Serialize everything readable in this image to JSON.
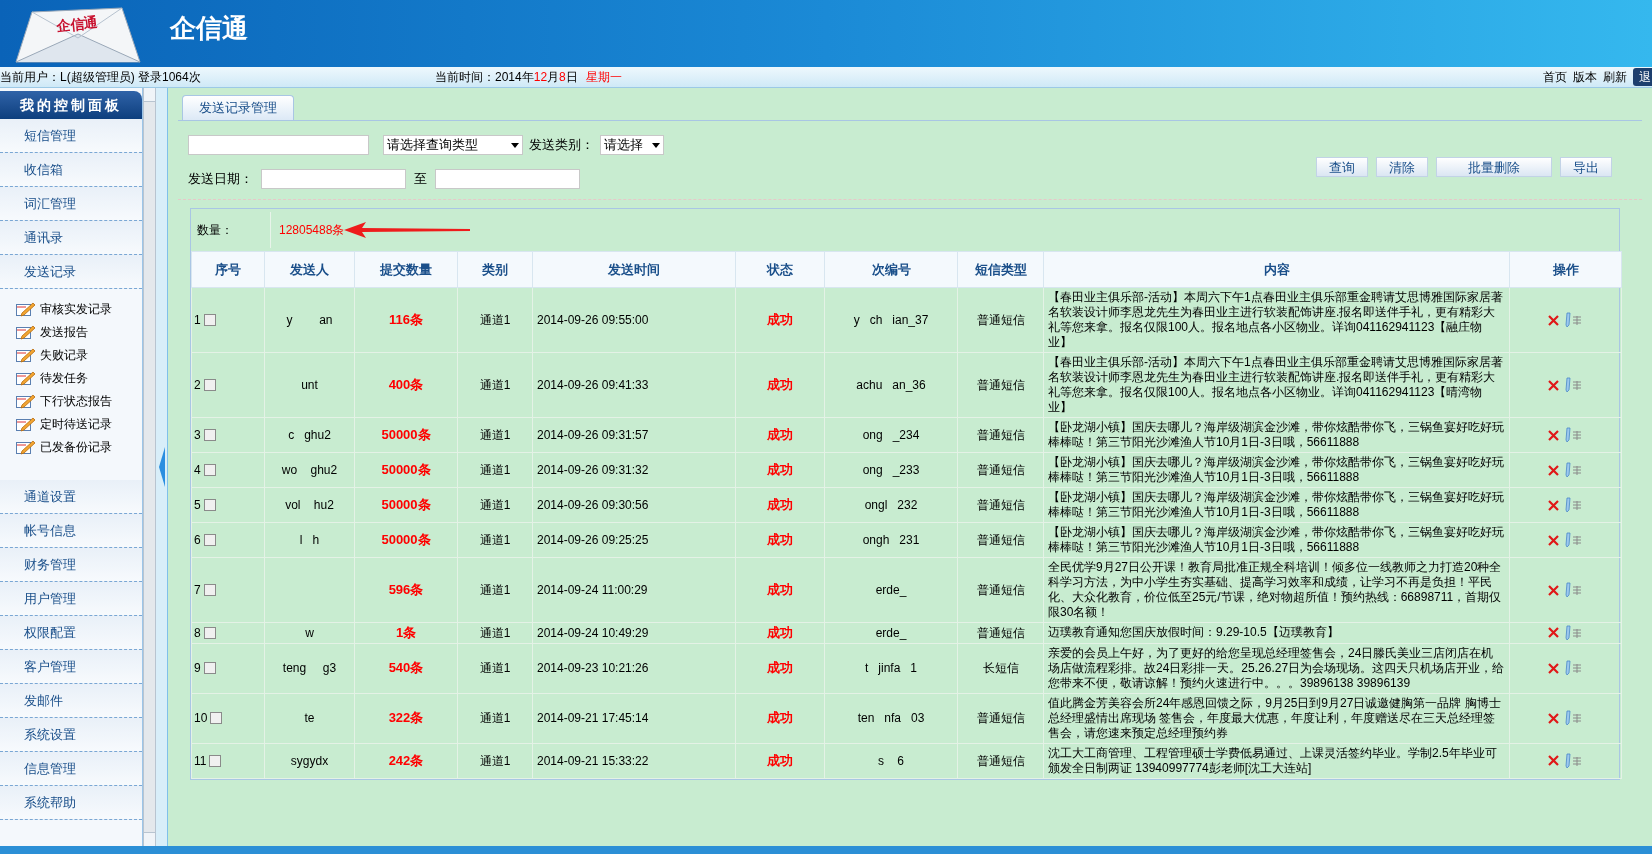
{
  "header": {
    "logo_text": "企信通",
    "brand": "企信通"
  },
  "info_bar": {
    "user": "当前用户：L(超级管理员) 登录1064次",
    "time_label": "当前时间：",
    "date_parts": [
      {
        "text": "2014年",
        "highlight": false
      },
      {
        "text": "12",
        "highlight": true
      },
      {
        "text": "月",
        "highlight": false
      },
      {
        "text": "8",
        "highlight": true
      },
      {
        "text": "日",
        "highlight": false
      }
    ],
    "weekday": "星期一",
    "links": [
      "首页",
      "版本",
      "刷新"
    ],
    "logout": "退"
  },
  "sidebar": {
    "title": "我的控制面板",
    "items": [
      {
        "label": "短信管理"
      },
      {
        "label": "收信箱"
      },
      {
        "label": "词汇管理"
      },
      {
        "label": "通讯录"
      },
      {
        "label": "发送记录",
        "children": [
          {
            "label": "审核实发记录"
          },
          {
            "label": "发送报告"
          },
          {
            "label": "失败记录"
          },
          {
            "label": "待发任务"
          },
          {
            "label": "下行状态报告"
          },
          {
            "label": "定时待送记录"
          },
          {
            "label": "已发备份记录"
          }
        ]
      },
      {
        "label": "通道设置"
      },
      {
        "label": "帐号信息"
      },
      {
        "label": "财务管理"
      },
      {
        "label": "用户管理"
      },
      {
        "label": "权限配置"
      },
      {
        "label": "客户管理"
      },
      {
        "label": "发邮件"
      },
      {
        "label": "系统设置"
      },
      {
        "label": "信息管理"
      },
      {
        "label": "系统帮助"
      }
    ]
  },
  "tabs": [
    {
      "label": "发送记录管理",
      "selected": true
    }
  ],
  "filters": {
    "query_type": "请选择查询类型",
    "category_label": "发送类别：",
    "category": "请选择",
    "date_label": "发送日期：",
    "date_separator": "至",
    "buttons": [
      "查询",
      "清除",
      "批量删除",
      "导出"
    ]
  },
  "summary": {
    "label": "数量：",
    "count": "12805488条"
  },
  "table": {
    "columns": [
      "序号",
      "发送人",
      "提交数量",
      "类别",
      "发送时间",
      "状态",
      "次编号",
      "短信类型",
      "内容",
      "操作"
    ],
    "rows": [
      {
        "index": "1",
        "checked": false,
        "sender": "y        an",
        "count": "116条",
        "channel": "通道1",
        "time": "2014-09-26 09:55:00",
        "status": "成功",
        "batch": "y   ch   ian_37",
        "type": "普通短信",
        "content": "【春田业主俱乐部-活动】本周六下午1点春田业主俱乐部重金聘请艾思博雅国际家居著名软装设计师李恩龙先生为春田业主进行软装配饰讲座.报名即送伴手礼，更有精彩大礼等您来拿。报名仅限100人。报名地点各小区物业。详询041162941123【融庄物业】"
      },
      {
        "index": "2",
        "checked": false,
        "sender": "unt",
        "count": "400条",
        "channel": "通道1",
        "time": "2014-09-26 09:41:33",
        "status": "成功",
        "batch": "achu   an_36",
        "type": "普通短信",
        "content": "【春田业主俱乐部-活动】本周六下午1点春田业主俱乐部重金聘请艾思博雅国际家居著名软装设计师李恩龙先生为春田业主进行软装配饰讲座.报名即送伴手礼，更有精彩大礼等您来拿。报名仅限100人。报名地点各小区物业。详询041162941123【晴湾物业】"
      },
      {
        "index": "3",
        "checked": false,
        "sender": "c   ghu2",
        "count": "50000条",
        "channel": "通道1",
        "time": "2014-09-26 09:31:57",
        "status": "成功",
        "batch": "ong   _234",
        "type": "普通短信",
        "content": "【卧龙湖小镇】国庆去哪儿？海岸级湖滨金沙滩，带你炫酷带你飞，三锅鱼宴好吃好玩棒棒哒！第三节阳光沙滩渔人节10月1日-3日哦，56611888"
      },
      {
        "index": "4",
        "checked": false,
        "sender": "wo    ghu2",
        "count": "50000条",
        "channel": "通道1",
        "time": "2014-09-26 09:31:32",
        "status": "成功",
        "batch": "ong   _233",
        "type": "普通短信",
        "content": "【卧龙湖小镇】国庆去哪儿？海岸级湖滨金沙滩，带你炫酷带你飞，三锅鱼宴好吃好玩棒棒哒！第三节阳光沙滩渔人节10月1日-3日哦，56611888"
      },
      {
        "index": "5",
        "checked": false,
        "sender": "vol    hu2",
        "count": "50000条",
        "channel": "通道1",
        "time": "2014-09-26 09:30:56",
        "status": "成功",
        "batch": "ongl   232",
        "type": "普通短信",
        "content": "【卧龙湖小镇】国庆去哪儿？海岸级湖滨金沙滩，带你炫酷带你飞，三锅鱼宴好吃好玩棒棒哒！第三节阳光沙滩渔人节10月1日-3日哦，56611888"
      },
      {
        "index": "6",
        "checked": false,
        "sender": "l   h",
        "count": "50000条",
        "channel": "通道1",
        "time": "2014-09-26 09:25:25",
        "status": "成功",
        "batch": "ongh   231",
        "type": "普通短信",
        "content": "【卧龙湖小镇】国庆去哪儿？海岸级湖滨金沙滩，带你炫酷带你飞，三锅鱼宴好吃好玩棒棒哒！第三节阳光沙滩渔人节10月1日-3日哦，56611888"
      },
      {
        "index": "7",
        "checked": false,
        "count": "596条",
        "channel": "通道1",
        "time": "2014-09-24 11:00:29",
        "status": "成功",
        "batch": "erde_",
        "type": "普通短信",
        "content": "全民优学9月27日公开课！教育局批准正规全科培训！倾多位一线教师之力打造20种全科学习方法，为中小学生夯实基础、提高学习效率和成绩，让学习不再是负担！平民化、大众化教育，价位低至25元/节课，绝对物超所值！预约热线：66898711，首期仅限30名额！"
      },
      {
        "index": "8",
        "checked": false,
        "sender": "w",
        "count": "1条",
        "channel": "通道1",
        "time": "2014-09-24 10:49:29",
        "status": "成功",
        "batch": "erde_",
        "type": "普通短信",
        "content": "迈璞教育通知您国庆放假时间：9.29-10.5【迈璞教育】"
      },
      {
        "index": "9",
        "checked": false,
        "sender": "teng     g3",
        "count": "540条",
        "channel": "通道1",
        "time": "2014-09-23 10:21:26",
        "status": "成功",
        "batch": "t   jinfa   1",
        "type": "长短信",
        "content": "亲爱的会员上午好，为了更好的给您呈现总经理签售会，24日滕氏美业三店闭店在机场店做流程彩排。故24日彩排一天。25.26.27日为会场现场。这四天只机场店开业，给您带来不便，敬请谅解！预约火速进行中。。。39896138 39896139"
      },
      {
        "index": "10",
        "checked": false,
        "sender": "te",
        "count": "322条",
        "channel": "通道1",
        "time": "2014-09-21 17:45:14",
        "status": "成功",
        "batch": "ten   nfa   03",
        "type": "普通短信",
        "content": "值此腾金芳美容会所24年感恩回馈之际，9月25日到9月27日诚邀健胸第一品牌 胸博士总经理盛情出席现场 签售会，年度最大优惠，年度让利，年度赠送尽在三天总经理签售会，请您速来预定总经理预约券"
      },
      {
        "index": "11",
        "checked": false,
        "sender": "sygydx",
        "count": "242条",
        "channel": "通道1",
        "time": "2014-09-21 15:33:22",
        "status": "成功",
        "batch": "s    6",
        "type": "普通短信",
        "content": "沈工大工商管理、工程管理硕士学费低易通过、上课灵活签约毕业。学制2.5年毕业可颁发全日制两证 13940997774彭老师[沈工大连站]"
      }
    ]
  }
}
